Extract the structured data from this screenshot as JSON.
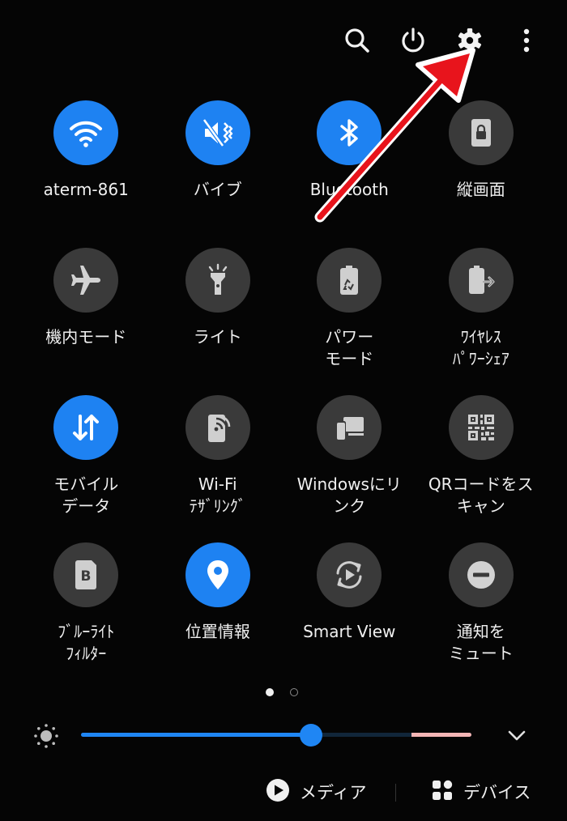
{
  "top_bar": {
    "icons": [
      "search-icon",
      "power-icon",
      "settings-gear-icon",
      "more-vertical-icon"
    ]
  },
  "tiles": [
    {
      "name": "wifi",
      "label": "aterm-861",
      "icon": "wifi-icon",
      "active": true
    },
    {
      "name": "vibrate",
      "label": "バイブ",
      "icon": "vibrate-icon",
      "active": true
    },
    {
      "name": "bluetooth",
      "label": "Bluetooth",
      "icon": "bluetooth-icon",
      "active": true
    },
    {
      "name": "portrait-lock",
      "label": "縦画面",
      "icon": "portrait-lock-icon",
      "active": false
    },
    {
      "name": "airplane-mode",
      "label": "機内モード",
      "icon": "airplane-icon",
      "active": false
    },
    {
      "name": "flashlight",
      "label": "ライト",
      "icon": "flashlight-icon",
      "active": false
    },
    {
      "name": "power-mode",
      "label": "パワー\nモード",
      "icon": "battery-recycle-icon",
      "active": false
    },
    {
      "name": "wireless-powershare",
      "label": "ﾜｲﾔﾚｽ\nﾊﾟﾜｰｼｪｱ",
      "icon": "wireless-share-icon",
      "active": false
    },
    {
      "name": "mobile-data",
      "label": "モバイル\nデータ",
      "icon": "data-arrows-icon",
      "active": true
    },
    {
      "name": "wifi-tethering",
      "label": "Wi-Fi\nﾃｻﾞﾘﾝｸﾞ",
      "icon": "hotspot-icon",
      "active": false
    },
    {
      "name": "link-to-windows",
      "label": "Windowsにリ\nンク",
      "icon": "devices-icon",
      "active": false
    },
    {
      "name": "qr-scanner",
      "label": "QRコードをス\nキャン",
      "icon": "qr-code-icon",
      "active": false
    },
    {
      "name": "blue-light-filter",
      "label": "ﾌﾞﾙｰﾗｲﾄ\nﾌｨﾙﾀｰ",
      "icon": "blue-light-b-icon",
      "active": false
    },
    {
      "name": "location",
      "label": "位置情報",
      "icon": "location-pin-icon",
      "active": true
    },
    {
      "name": "smart-view",
      "label": "Smart View",
      "icon": "smart-view-icon",
      "active": false
    },
    {
      "name": "mute-notifications",
      "label": "通知を\nミュート",
      "icon": "minus-circle-icon",
      "active": false
    }
  ],
  "pager": {
    "pages": 2,
    "current": 1
  },
  "brightness": {
    "level": 0.59
  },
  "bottom": {
    "media_label": "メディア",
    "devices_label": "デバイス"
  },
  "colors": {
    "background": "#050505",
    "tile_off": "#3a3a3a",
    "tile_on": "#1e82f2",
    "accent": "#1f86f4",
    "annotation_arrow": "#e8141c"
  }
}
